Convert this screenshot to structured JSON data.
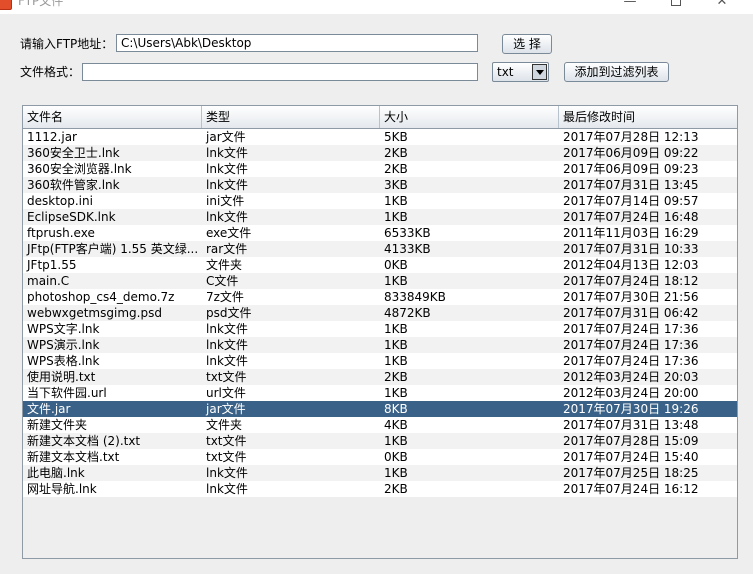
{
  "window": {
    "title": "FTP文件",
    "minimize": "—",
    "close": "✕"
  },
  "form": {
    "path_label": "请输入FTP地址：",
    "path_value": "C:\\Users\\Abk\\Desktop",
    "select_button": "选 择",
    "format_label": "文件格式：",
    "format_value": "",
    "filter_selected": "txt",
    "add_filter_button": "添加到过滤列表"
  },
  "table": {
    "columns": [
      "文件名",
      "类型",
      "大小",
      "最后修改时间"
    ],
    "rows": [
      [
        "1112.jar",
        "jar文件",
        "5KB",
        "2017年07月28日 12:13"
      ],
      [
        "360安全卫士.lnk",
        "lnk文件",
        "2KB",
        "2017年06月09日 09:22"
      ],
      [
        "360安全浏览器.lnk",
        "lnk文件",
        "2KB",
        "2017年06月09日 09:23"
      ],
      [
        "360软件管家.lnk",
        "lnk文件",
        "3KB",
        "2017年07月31日 13:45"
      ],
      [
        "desktop.ini",
        "ini文件",
        "1KB",
        "2017年07月14日 09:57"
      ],
      [
        "EclipseSDK.lnk",
        "lnk文件",
        "1KB",
        "2017年07月24日 16:48"
      ],
      [
        "ftprush.exe",
        "exe文件",
        "6533KB",
        "2011年11月03日 16:29"
      ],
      [
        "JFtp(FTP客户端) 1.55 英文绿...",
        "rar文件",
        "4133KB",
        "2017年07月31日 10:33"
      ],
      [
        "JFtp1.55",
        "文件夹",
        "0KB",
        "2012年04月13日 12:03"
      ],
      [
        "main.C",
        "C文件",
        "1KB",
        "2017年07月24日 18:12"
      ],
      [
        "photoshop_cs4_demo.7z",
        "7z文件",
        "833849KB",
        "2017年07月30日 21:56"
      ],
      [
        "webwxgetmsgimg.psd",
        "psd文件",
        "4872KB",
        "2017年07月31日 06:42"
      ],
      [
        "WPS文字.lnk",
        "lnk文件",
        "1KB",
        "2017年07月24日 17:36"
      ],
      [
        "WPS演示.lnk",
        "lnk文件",
        "1KB",
        "2017年07月24日 17:36"
      ],
      [
        "WPS表格.lnk",
        "lnk文件",
        "1KB",
        "2017年07月24日 17:36"
      ],
      [
        "使用说明.txt",
        "txt文件",
        "2KB",
        "2012年03月24日 20:03"
      ],
      [
        "当下软件园.url",
        "url文件",
        "1KB",
        "2012年03月24日 20:00"
      ],
      [
        "文件.jar",
        "jar文件",
        "8KB",
        "2017年07月30日 19:26"
      ],
      [
        "新建文件夹",
        "文件夹",
        "4KB",
        "2017年07月31日 13:48"
      ],
      [
        "新建文本文档 (2).txt",
        "txt文件",
        "1KB",
        "2017年07月28日 15:09"
      ],
      [
        "新建文本文档.txt",
        "txt文件",
        "0KB",
        "2017年07月24日 15:40"
      ],
      [
        "此电脑.lnk",
        "lnk文件",
        "1KB",
        "2017年07月25日 18:25"
      ],
      [
        "网址导航.lnk",
        "lnk文件",
        "2KB",
        "2017年07月24日 16:12"
      ]
    ],
    "selected_row": 17
  },
  "colors": {
    "selection": "#3a6187",
    "background": "#eeeeee"
  }
}
